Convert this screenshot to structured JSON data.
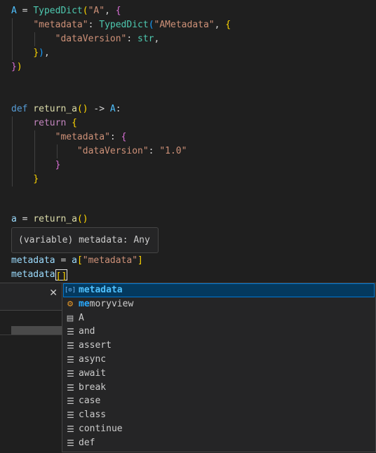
{
  "code": {
    "l1": {
      "var": "A",
      "eq": " = ",
      "fn": "TypedDict",
      "open": "(",
      "str": "\"A\"",
      "comma": ", ",
      "brace": "{"
    },
    "l2": {
      "str": "\"metadata\"",
      "colon": ": ",
      "fn": "TypedDict",
      "open": "(",
      "str2": "\"AMetadata\"",
      "comma": ", ",
      "brace": "{"
    },
    "l3": {
      "str": "\"dataVersion\"",
      "colon": ": ",
      "cls": "str",
      "comma": ","
    },
    "l4": {
      "brace": "}",
      "paren": ")",
      "comma": ","
    },
    "l5": {
      "brace": "}",
      "paren": ")"
    },
    "l8": {
      "kw": "def",
      "fn": " return_a",
      "paren": "()",
      "arrow": " -> ",
      "cls": "A",
      "colon": ":"
    },
    "l9": {
      "kw": "return",
      "brace": " {"
    },
    "l10": {
      "str": "\"metadata\"",
      "colon": ": ",
      "brace": "{"
    },
    "l11": {
      "str": "\"dataVersion\"",
      "colon": ": ",
      "str2": "\"1.0\""
    },
    "l12": {
      "brace": "}"
    },
    "l13": {
      "brace": "}"
    },
    "l16": {
      "var": "a",
      "eq": " = ",
      "fn": "return_a",
      "paren": "()"
    },
    "l18": {
      "var": "metadata",
      "eq": " = ",
      "var2": "a",
      "open": "[",
      "str": "\"metadata\"",
      "close": "]"
    },
    "l19": {
      "var": "metadata",
      "open": "[",
      "close": "]"
    }
  },
  "hover": {
    "text": "(variable) metadata: Any"
  },
  "panel": {
    "close_icon": "close-icon",
    "close_glyph": "✕"
  },
  "suggest": {
    "items": [
      {
        "label": "metadata",
        "icon": "variable-icon",
        "match": "metadata",
        "rest": ""
      },
      {
        "label": "memoryview",
        "icon": "class-icon",
        "match": "me",
        "rest": "moryview"
      },
      {
        "label": "A",
        "icon": "module-icon",
        "match": "",
        "rest": "A"
      },
      {
        "label": "and",
        "icon": "keyword-icon",
        "match": "",
        "rest": "and"
      },
      {
        "label": "assert",
        "icon": "keyword-icon",
        "match": "",
        "rest": "assert"
      },
      {
        "label": "async",
        "icon": "keyword-icon",
        "match": "",
        "rest": "async"
      },
      {
        "label": "await",
        "icon": "keyword-icon",
        "match": "",
        "rest": "await"
      },
      {
        "label": "break",
        "icon": "keyword-icon",
        "match": "",
        "rest": "break"
      },
      {
        "label": "case",
        "icon": "keyword-icon",
        "match": "",
        "rest": "case"
      },
      {
        "label": "class",
        "icon": "keyword-icon",
        "match": "",
        "rest": "class"
      },
      {
        "label": "continue",
        "icon": "keyword-icon",
        "match": "",
        "rest": "continue"
      },
      {
        "label": "def",
        "icon": "keyword-icon",
        "match": "",
        "rest": "def"
      }
    ]
  },
  "colors": {
    "selected_bg": "#04395e",
    "accent": "#0078d4",
    "background": "#1f1f1f"
  }
}
